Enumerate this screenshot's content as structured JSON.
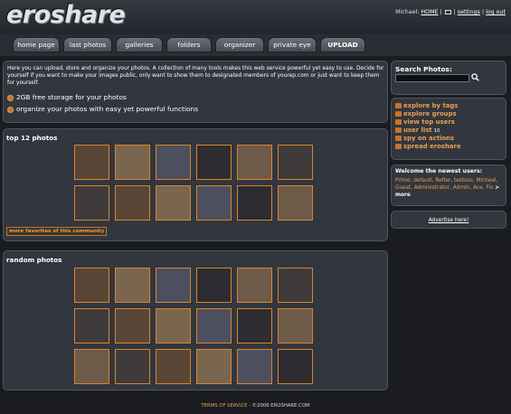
{
  "header": {
    "logo": "eroshare",
    "user": "Michael",
    "home_link": "HOME",
    "mail_sep": "|",
    "settings_link": "settings",
    "logout_link": "log out"
  },
  "nav": {
    "tabs": [
      {
        "label": "home page"
      },
      {
        "label": "last photos"
      },
      {
        "label": "galleries"
      },
      {
        "label": "folders"
      },
      {
        "label": "organizer"
      },
      {
        "label": "private eye"
      },
      {
        "label": "UPLOAD"
      }
    ]
  },
  "intro": {
    "text": "Here you can upload, store and organize your photos. A collection of many tools makes this web service powerful yet easy to use. Decide for yourself if you want to make your images public, only want to show them to designated members of yourep.com or just want to keep them for yourself.",
    "features": [
      "2GB free storage for your photos",
      "organize your photos with easy yet powerful functions"
    ]
  },
  "top_photos": {
    "title": "top 12 photos",
    "more_link": "more favorites of this community"
  },
  "random_photos": {
    "title": "random photos"
  },
  "sidebar": {
    "search_title": "Search Photos:",
    "links": [
      {
        "label": "explore by tags",
        "icon": "tag-icon"
      },
      {
        "label": "explore groups",
        "icon": "groups-icon"
      },
      {
        "label": "view top users",
        "icon": "user-icon"
      },
      {
        "label": "user list",
        "icon": "list-icon",
        "count": "10"
      },
      {
        "label": "spy on actions",
        "icon": "eye-icon"
      },
      {
        "label": "spread eroshare",
        "icon": "share-icon"
      }
    ],
    "newest_title": "Welcome the newest users:",
    "newest_users": "Primo, default, Refler, testsso, Micheal, Guest, Administrator, Admin, Ace, Fio",
    "newest_more": "> more",
    "advertise": "Advertise here!"
  },
  "footer": {
    "tos": "TERMS OF SERVICE",
    "copyright": "- ©2006 EROSHARE.COM"
  },
  "colors": {
    "accent": "#e8a04f",
    "background": "#1b1c21",
    "panel": "#32363e",
    "thumb_border": "#d8852f"
  }
}
